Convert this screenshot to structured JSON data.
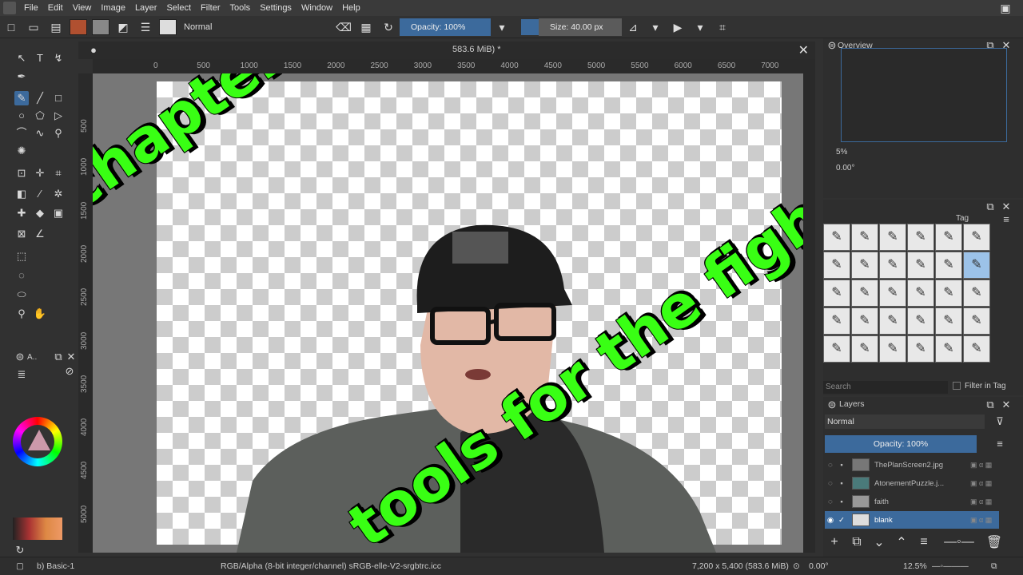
{
  "menu": [
    "File",
    "Edit",
    "View",
    "Image",
    "Layer",
    "Select",
    "Filter",
    "Tools",
    "Settings",
    "Window",
    "Help"
  ],
  "toolbar": {
    "blend_mode": "Normal",
    "opacity": "Opacity: 100%",
    "size": "Size: 40.00 px"
  },
  "document": {
    "tab_title": "583.6 MiB) *"
  },
  "ruler_h": [
    "0",
    "500",
    "1000",
    "1500",
    "2000",
    "2500",
    "3000",
    "3500",
    "4000",
    "4500",
    "5000",
    "5500",
    "6000",
    "6500",
    "7000"
  ],
  "ruler_v": [
    "500",
    "1000",
    "1500",
    "2000",
    "2500",
    "3000",
    "3500",
    "4000",
    "4500",
    "5000"
  ],
  "overview": {
    "title": "Overview",
    "zoom": "5%",
    "angle": "0.00°"
  },
  "brushes": {
    "tag_label": "Tag",
    "search_placeholder": "Search",
    "filter_in_tag": "Filter in Tag"
  },
  "layers": {
    "title": "Layers",
    "blend_mode": "Normal",
    "opacity": "Opacity:  100%",
    "items": [
      {
        "name": "ThePlanScreen2.jpg",
        "selected": false
      },
      {
        "name": "AtonementPuzzle.j...",
        "selected": false
      },
      {
        "name": "faith",
        "selected": false
      },
      {
        "name": "blank",
        "selected": true
      }
    ]
  },
  "status": {
    "brush": "b) Basic-1",
    "color_space": "RGB/Alpha (8-bit integer/channel)  sRGB-elle-V2-srgbtrc.icc",
    "image_size": "7,200 x 5,400 (583.6 MiB)",
    "angle": "0.00°",
    "zoom": "12.5%"
  },
  "overlay": {
    "line1": "chapter four",
    "line2": "tools for the fight"
  },
  "colors": {
    "accent": "#3c6a9c",
    "overlay_text": "#39ff14"
  }
}
